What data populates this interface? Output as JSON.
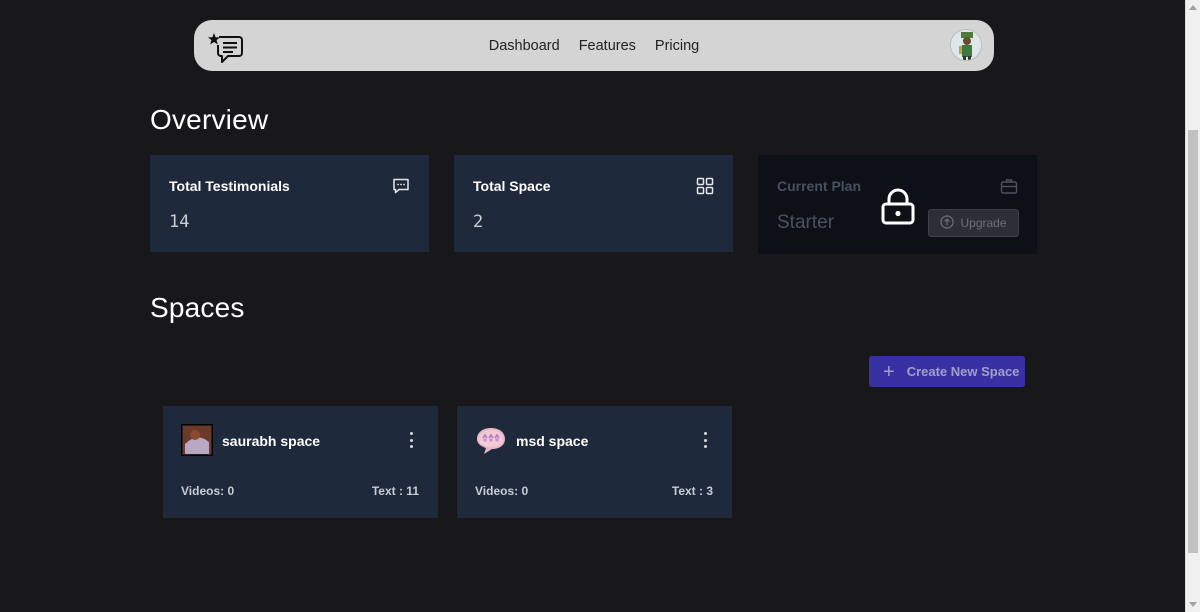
{
  "nav": {
    "links": [
      "Dashboard",
      "Features",
      "Pricing"
    ],
    "logo_icon": "chat-star-logo-icon",
    "avatar_icon": "user-avatar"
  },
  "overview": {
    "title": "Overview",
    "cards": [
      {
        "label": "Total Testimonials",
        "value": "14",
        "icon": "message-icon"
      },
      {
        "label": "Total Space",
        "value": "2",
        "icon": "grid-icon"
      },
      {
        "label": "Current Plan",
        "value": "Starter",
        "icon": "briefcase-icon",
        "locked": true,
        "button": "Upgrade"
      }
    ]
  },
  "spaces": {
    "title": "Spaces",
    "create_button": "Create New Space",
    "items": [
      {
        "name": "saurabh space",
        "videos": "Videos: 0",
        "text": "Text : 11"
      },
      {
        "name": "msd space",
        "videos": "Videos: 0",
        "text": "Text : 3"
      }
    ]
  },
  "colors": {
    "background": "#18181b",
    "card": "#1e293b",
    "accent": "#4338ca",
    "navbar": "#d4d4d4"
  }
}
